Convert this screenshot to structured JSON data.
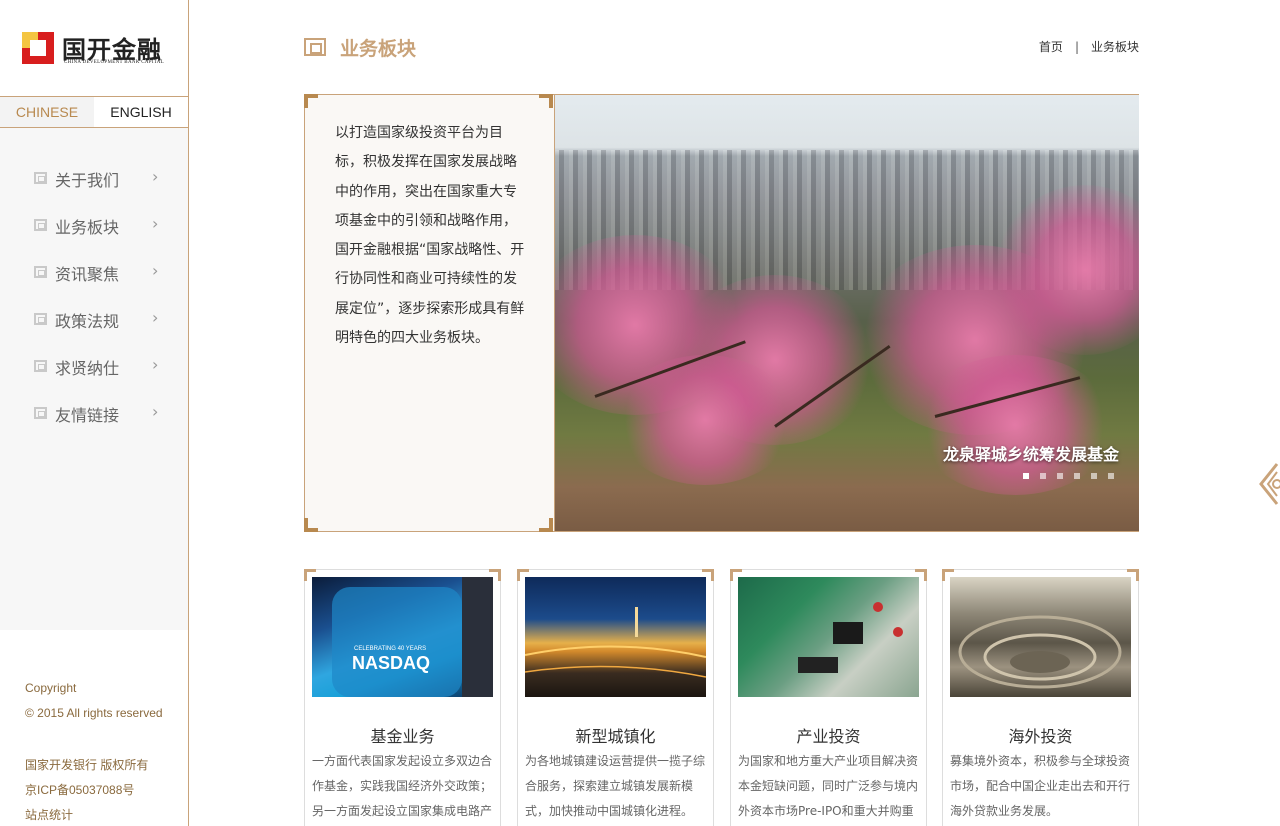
{
  "sidebar": {
    "logo": {
      "cn": "国开金融",
      "en": "CHINA DEVELOPMENT BANK CAPITAL"
    },
    "lang": {
      "chinese": "CHINESE",
      "english": "ENGLISH"
    },
    "nav": [
      {
        "label": "关于我们",
        "icon": "square-spiral-icon"
      },
      {
        "label": "业务板块",
        "icon": "square-spiral-icon"
      },
      {
        "label": "资讯聚焦",
        "icon": "square-spiral-icon"
      },
      {
        "label": "政策法规",
        "icon": "square-spiral-icon"
      },
      {
        "label": "求贤纳仕",
        "icon": "square-spiral-icon"
      },
      {
        "label": "友情链接",
        "icon": "square-spiral-icon"
      }
    ],
    "chevron": "›",
    "footer": {
      "copyright": "Copyright",
      "rights": "© 2015 All rights reserved",
      "owner": "国家开发银行 版权所有",
      "icp": "京ICP备05037088号",
      "stats": "站点统计"
    }
  },
  "header": {
    "title": "业务板块",
    "breadcrumb": {
      "home": "首页",
      "sep": "|",
      "current": "业务板块"
    }
  },
  "hero": {
    "description": "以打造国家级投资平台为目标，积极发挥在国家发展战略中的作用，突出在国家重大专项基金中的引领和战略作用，国开金融根据“国家战略性、开行协同性和商业可持续性的发展定位”，逐步探索形成具有鲜明特色的四大业务板块。",
    "caption": "龙泉驿城乡统筹发展基金",
    "dot_count": 6
  },
  "cards": [
    {
      "title": "基金业务",
      "desc": "一方面代表国家发起设立多双边合作基金，实践我国经济外交政策；另一方面发起设立国家集成电路产",
      "image": "nasdaq-building"
    },
    {
      "title": "新型城镇化",
      "desc": "为各地城镇建设运营提供一揽子综合服务，探索建立城镇发展新模式，加快推动中国城镇化进程。",
      "image": "city-night"
    },
    {
      "title": "产业投资",
      "desc": "为国家和地方重大产业项目解决资本金短缺问题，同时广泛参与境内外资本市场Pre-IPO和重大并购重",
      "image": "circuit-board"
    },
    {
      "title": "海外投资",
      "desc": "募集境外资本，积极参与全球投资市场，配合中国企业走出去和开行海外贷款业务发展。",
      "image": "open-pit-mine"
    }
  ],
  "colors": {
    "accent": "#c9a37a",
    "accent_dark": "#b8894f",
    "logo_red": "#d81e1e"
  }
}
